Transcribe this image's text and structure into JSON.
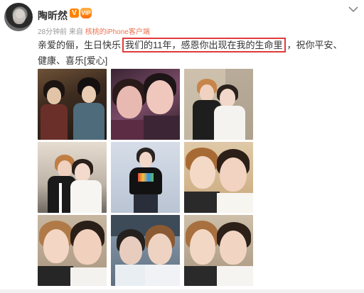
{
  "post": {
    "username": "陶昕然",
    "verified_badge": "V",
    "vip_badge": "VIP",
    "time": "28分钟前",
    "source_prefix": "来自",
    "source": "核桃的iPhone客户端",
    "text_before": "亲爱的俪，生日快乐",
    "text_highlight": "我们的11年，感恩你出现在我的生命里",
    "text_after": "，祝你平安、健康、喜乐[爱心]",
    "highlight_color": "#e03a3a",
    "accent_color": "#ff8200"
  },
  "icons": {
    "menu": "chevron-down-icon"
  },
  "photos": [
    {
      "label": "period-drama-still"
    },
    {
      "label": "selfie-pink-light"
    },
    {
      "label": "two-women-hug"
    },
    {
      "label": "two-women-hug-closeup"
    },
    {
      "label": "woman-black-tshirt"
    },
    {
      "label": "selfie-warm"
    },
    {
      "label": "selfie-close"
    },
    {
      "label": "selfie-car"
    },
    {
      "label": "selfie-smile"
    }
  ]
}
